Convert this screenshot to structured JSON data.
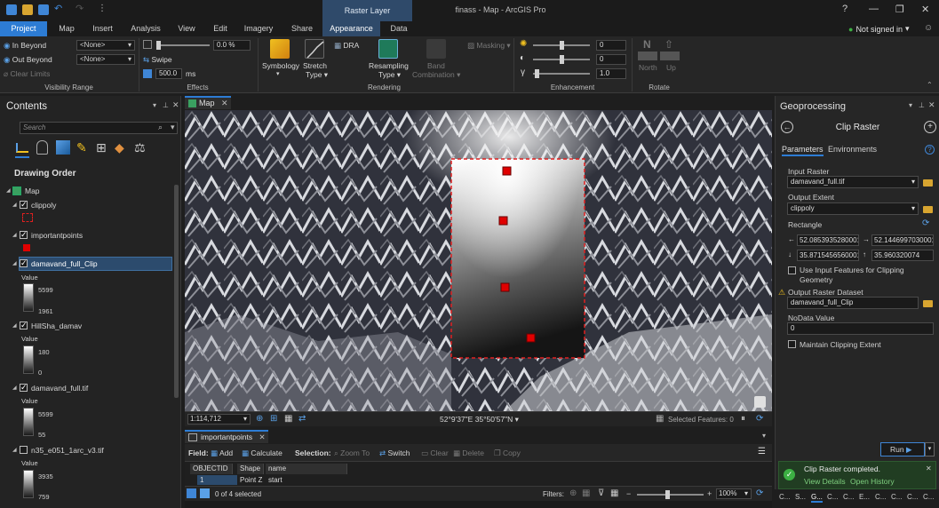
{
  "window": {
    "title": "finass - Map - ArcGIS Pro",
    "context_tab": "Raster Layer",
    "help": "?",
    "signed_in": "Not signed in"
  },
  "ribbon_tabs": [
    "Project",
    "Map",
    "Insert",
    "Analysis",
    "View",
    "Edit",
    "Imagery",
    "Share",
    "Appearance",
    "Data"
  ],
  "ribbon": {
    "visibility_range": {
      "in_beyond": "In Beyond",
      "out_beyond": "Out Beyond",
      "in_value": "<None>",
      "out_value": "<None>",
      "clear_limits": "Clear Limits",
      "label": "Visibility Range"
    },
    "effects": {
      "transparency": "0.0 %",
      "swipe": "Swipe",
      "flicker": "500.0",
      "flicker_unit": "ms",
      "label": "Effects"
    },
    "rendering": {
      "symbology": "Symbology",
      "stretch": "Stretch",
      "stretch2": "Type",
      "dra": "DRA",
      "resampling": "Resampling",
      "resampling2": "Type",
      "band": "Band",
      "band2": "Combination",
      "masking": "Masking",
      "label": "Rendering"
    },
    "enhancement": {
      "brightness": "0",
      "contrast": "0",
      "gamma": "1.0",
      "label": "Enhancement"
    },
    "rotate": {
      "north": "North",
      "up": "Up",
      "label": "Rotate"
    }
  },
  "contents": {
    "title": "Contents",
    "search_placeholder": "Search",
    "drawing_order": "Drawing Order",
    "layers": {
      "map": "Map",
      "clippoly": "clippoly",
      "importantpoints": "importantpoints",
      "clip": {
        "name": "damavand_full_Clip",
        "value_label": "Value",
        "max": "5599",
        "min": "1961"
      },
      "hillshade": {
        "name": "HillSha_damav",
        "value_label": "Value",
        "max": "180",
        "min": "0"
      },
      "full": {
        "name": "damavand_full.tif",
        "value_label": "Value",
        "max": "5599",
        "min": "55"
      },
      "n35": {
        "name": "n35_e051_1arc_v3.tif",
        "value_label": "Value",
        "max": "3935",
        "min": "759"
      }
    }
  },
  "map": {
    "tab": "Map",
    "scale": "1:114,712",
    "coords": "52°9'37\"E 35°50'57\"N",
    "selected_features": "Selected Features: 0"
  },
  "attribute_table": {
    "tab": "importantpoints",
    "field_label": "Field:",
    "add": "Add",
    "calculate": "Calculate",
    "selection_label": "Selection:",
    "zoom_to": "Zoom To",
    "switch": "Switch",
    "clear": "Clear",
    "delete": "Delete",
    "copy": "Copy",
    "columns": [
      "OBJECTID",
      "Shape",
      "name"
    ],
    "rows": [
      [
        "1",
        "Point Z",
        "start"
      ]
    ],
    "status": "0 of 4 selected",
    "filters": "Filters:",
    "zoom": "100%"
  },
  "geoprocessing": {
    "title": "Geoprocessing",
    "tool": "Clip Raster",
    "tabs": [
      "Parameters",
      "Environments"
    ],
    "input_raster_label": "Input Raster",
    "input_raster": "damavand_full.tif",
    "output_extent_label": "Output Extent",
    "output_extent": "clippoly",
    "rectangle_label": "Rectangle",
    "rect_left": "52.0853935280001",
    "rect_right": "52.1446997030001",
    "rect_bottom": "35.8715456560001",
    "rect_top": "35.960320074",
    "use_input_features": "Use Input Features for Clipping Geometry",
    "output_dataset_label": "Output Raster Dataset",
    "output_dataset": "damavand_full_Clip",
    "nodata_label": "NoData Value",
    "nodata": "0",
    "maintain_extent": "Maintain Clipping Extent",
    "run": "Run",
    "toast_title": "Clip Raster completed.",
    "toast_details": "View Details",
    "toast_history": "Open History",
    "bottom_tabs": [
      "C...",
      "S...",
      "G...",
      "C...",
      "C...",
      "E...",
      "C...",
      "C...",
      "C...",
      "C..."
    ]
  },
  "colors": {
    "accent": "#2d7cd4",
    "context_tab": "#2f4a6a",
    "clip_outline": "#e02020",
    "point": "#e00000",
    "success": "#3cb043"
  }
}
